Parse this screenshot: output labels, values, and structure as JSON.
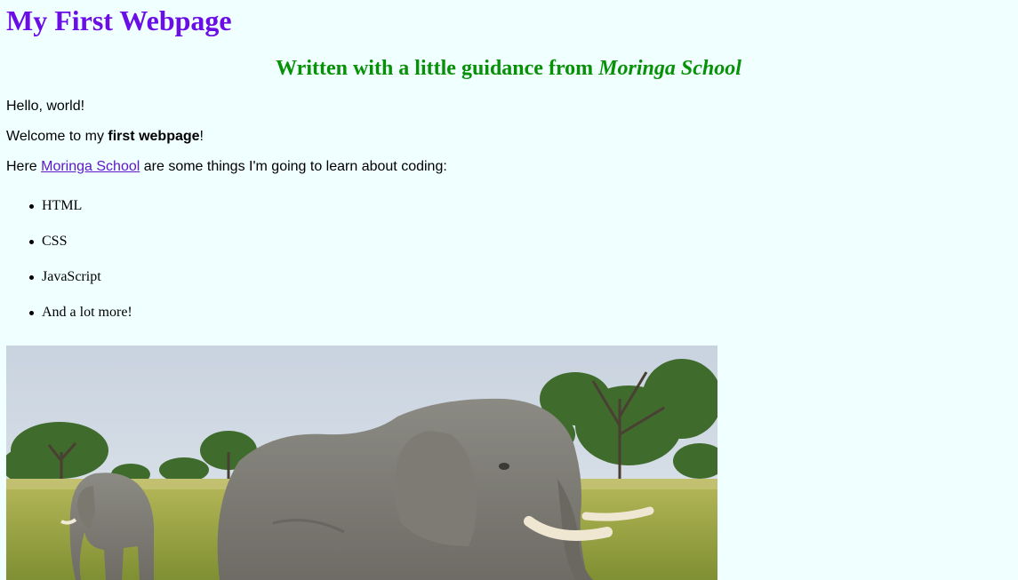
{
  "heading": "My First Webpage",
  "subheading": {
    "prefix": "Written with a little guidance from ",
    "school": "Moringa School"
  },
  "paragraphs": {
    "greeting": "Hello, world!",
    "welcome_prefix": "Welcome to my ",
    "welcome_bold": "first webpage",
    "welcome_suffix": "!",
    "here_prefix": "Here ",
    "here_link": "Moringa School",
    "here_suffix": " are some things I'm going to learn about coding:"
  },
  "topics": [
    "HTML",
    "CSS",
    "JavaScript",
    "And a lot more!"
  ],
  "image": {
    "subject": "elephants in grassland",
    "icon": "elephant-photo"
  },
  "colors": {
    "background": "#F0FFFF",
    "heading": "#6A0DE6",
    "subheading": "#079107",
    "link": "#5b16c9"
  }
}
